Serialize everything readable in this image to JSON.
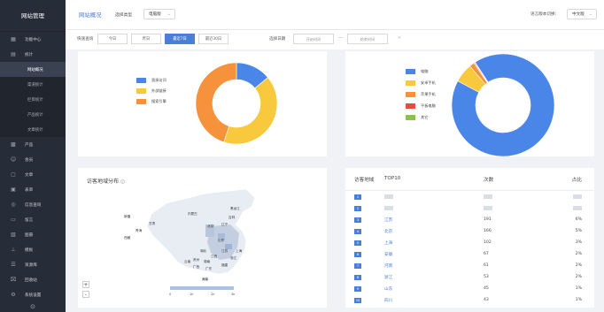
{
  "sidebar": {
    "title": "网站管理",
    "items": [
      {
        "label": "功能中心",
        "icon": "function-grid-icon"
      },
      {
        "label": "统计",
        "icon": "statistics-icon"
      }
    ],
    "sub_items": [
      "网站概况",
      "渠道统计",
      "栏目统计",
      "产品统计",
      "文章统计"
    ],
    "more_items": [
      {
        "label": "产品",
        "icon": "product-icon"
      },
      {
        "label": "会员",
        "icon": "member-icon"
      },
      {
        "label": "文章",
        "icon": "article-icon"
      },
      {
        "label": "表单",
        "icon": "form-icon"
      },
      {
        "label": "信息查询",
        "icon": "search-info-icon"
      },
      {
        "label": "留言",
        "icon": "message-icon"
      },
      {
        "label": "图册",
        "icon": "album-icon"
      },
      {
        "label": "模板",
        "icon": "template-icon"
      },
      {
        "label": "资源库",
        "icon": "resource-icon"
      },
      {
        "label": "回收站",
        "icon": "trash-icon"
      },
      {
        "label": "系统设置",
        "icon": "settings-icon"
      }
    ],
    "footer_icon": "help-icon"
  },
  "topbar": {
    "title": "网站概况",
    "type_label": "选择类型",
    "type_value": "电脑版",
    "lang_label": "语言版本切换：",
    "lang_value": "中文版"
  },
  "filter": {
    "quick_label": "快速查询",
    "buttons": [
      "今日",
      "昨日",
      "最近7日",
      "最近30日"
    ],
    "active_index": 2,
    "date_label": "选择日期",
    "start_placeholder": "开始时间",
    "end_placeholder": "结束时间",
    "dash": "—",
    "clear": "×"
  },
  "source_chart": {
    "legend": [
      "直接访问",
      "外部链接",
      "搜索引擎"
    ],
    "colors": [
      "#4a86e8",
      "#f8c93c",
      "#f5923b"
    ],
    "values": [
      14,
      41,
      45
    ]
  },
  "device_chart": {
    "legend": [
      "电脑",
      "安卓手机",
      "苹果手机",
      "平板电脑",
      "其它"
    ],
    "colors": [
      "#4a86e8",
      "#f8c93c",
      "#f5923b",
      "#e84c3d",
      "#8bc34a"
    ],
    "values": [
      92,
      6,
      1.5,
      0.3,
      0.2
    ]
  },
  "map_card": {
    "title": "访客地域分布",
    "help_icon": "question-icon",
    "labels": [
      "新疆",
      "西藏",
      "青海",
      "甘肃",
      "内蒙古",
      "黑龙江",
      "吉林",
      "辽宁",
      "北京",
      "山东",
      "江苏",
      "上海",
      "浙江",
      "福建",
      "江西",
      "湖南",
      "湖北",
      "贵州",
      "云南",
      "广西",
      "广东",
      "海南"
    ],
    "zoom_in": "+",
    "zoom_out": "-",
    "scale": [
      "0",
      "1k",
      "2k",
      "3k"
    ]
  },
  "top10": {
    "title": "访客地域",
    "subtitle": "TOP10",
    "col_count": "次数",
    "col_pct": "占比",
    "rows": [
      {
        "rank": "1",
        "name": "",
        "count": "",
        "pct": ""
      },
      {
        "rank": "2",
        "name": "",
        "count": "",
        "pct": ""
      },
      {
        "rank": "3",
        "name": "江苏",
        "count": "191",
        "pct": "6%"
      },
      {
        "rank": "4",
        "name": "北京",
        "count": "166",
        "pct": "5%"
      },
      {
        "rank": "5",
        "name": "上海",
        "count": "102",
        "pct": "3%"
      },
      {
        "rank": "6",
        "name": "安徽",
        "count": "67",
        "pct": "2%"
      },
      {
        "rank": "7",
        "name": "河南",
        "count": "61",
        "pct": "2%"
      },
      {
        "rank": "8",
        "name": "浙江",
        "count": "53",
        "pct": "2%"
      },
      {
        "rank": "9",
        "name": "山东",
        "count": "45",
        "pct": "1%"
      },
      {
        "rank": "10",
        "name": "四川",
        "count": "43",
        "pct": "1%"
      }
    ]
  }
}
